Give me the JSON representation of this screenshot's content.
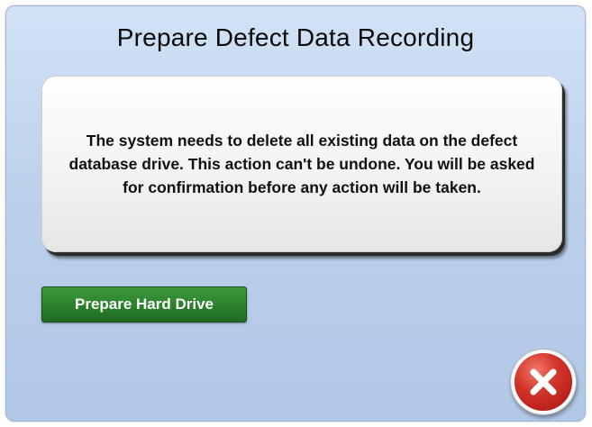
{
  "dialog": {
    "title": "Prepare Defect Data Recording",
    "message": "The system needs to delete all existing data on the defect database drive. This action can't be undone. You will be asked for confirmation before any action will be taken.",
    "prepare_button_label": "Prepare Hard Drive",
    "close_icon": "close-x-icon"
  },
  "colors": {
    "background": "#c3d6ef",
    "button_green": "#2c822c",
    "close_red": "#d3342a"
  }
}
